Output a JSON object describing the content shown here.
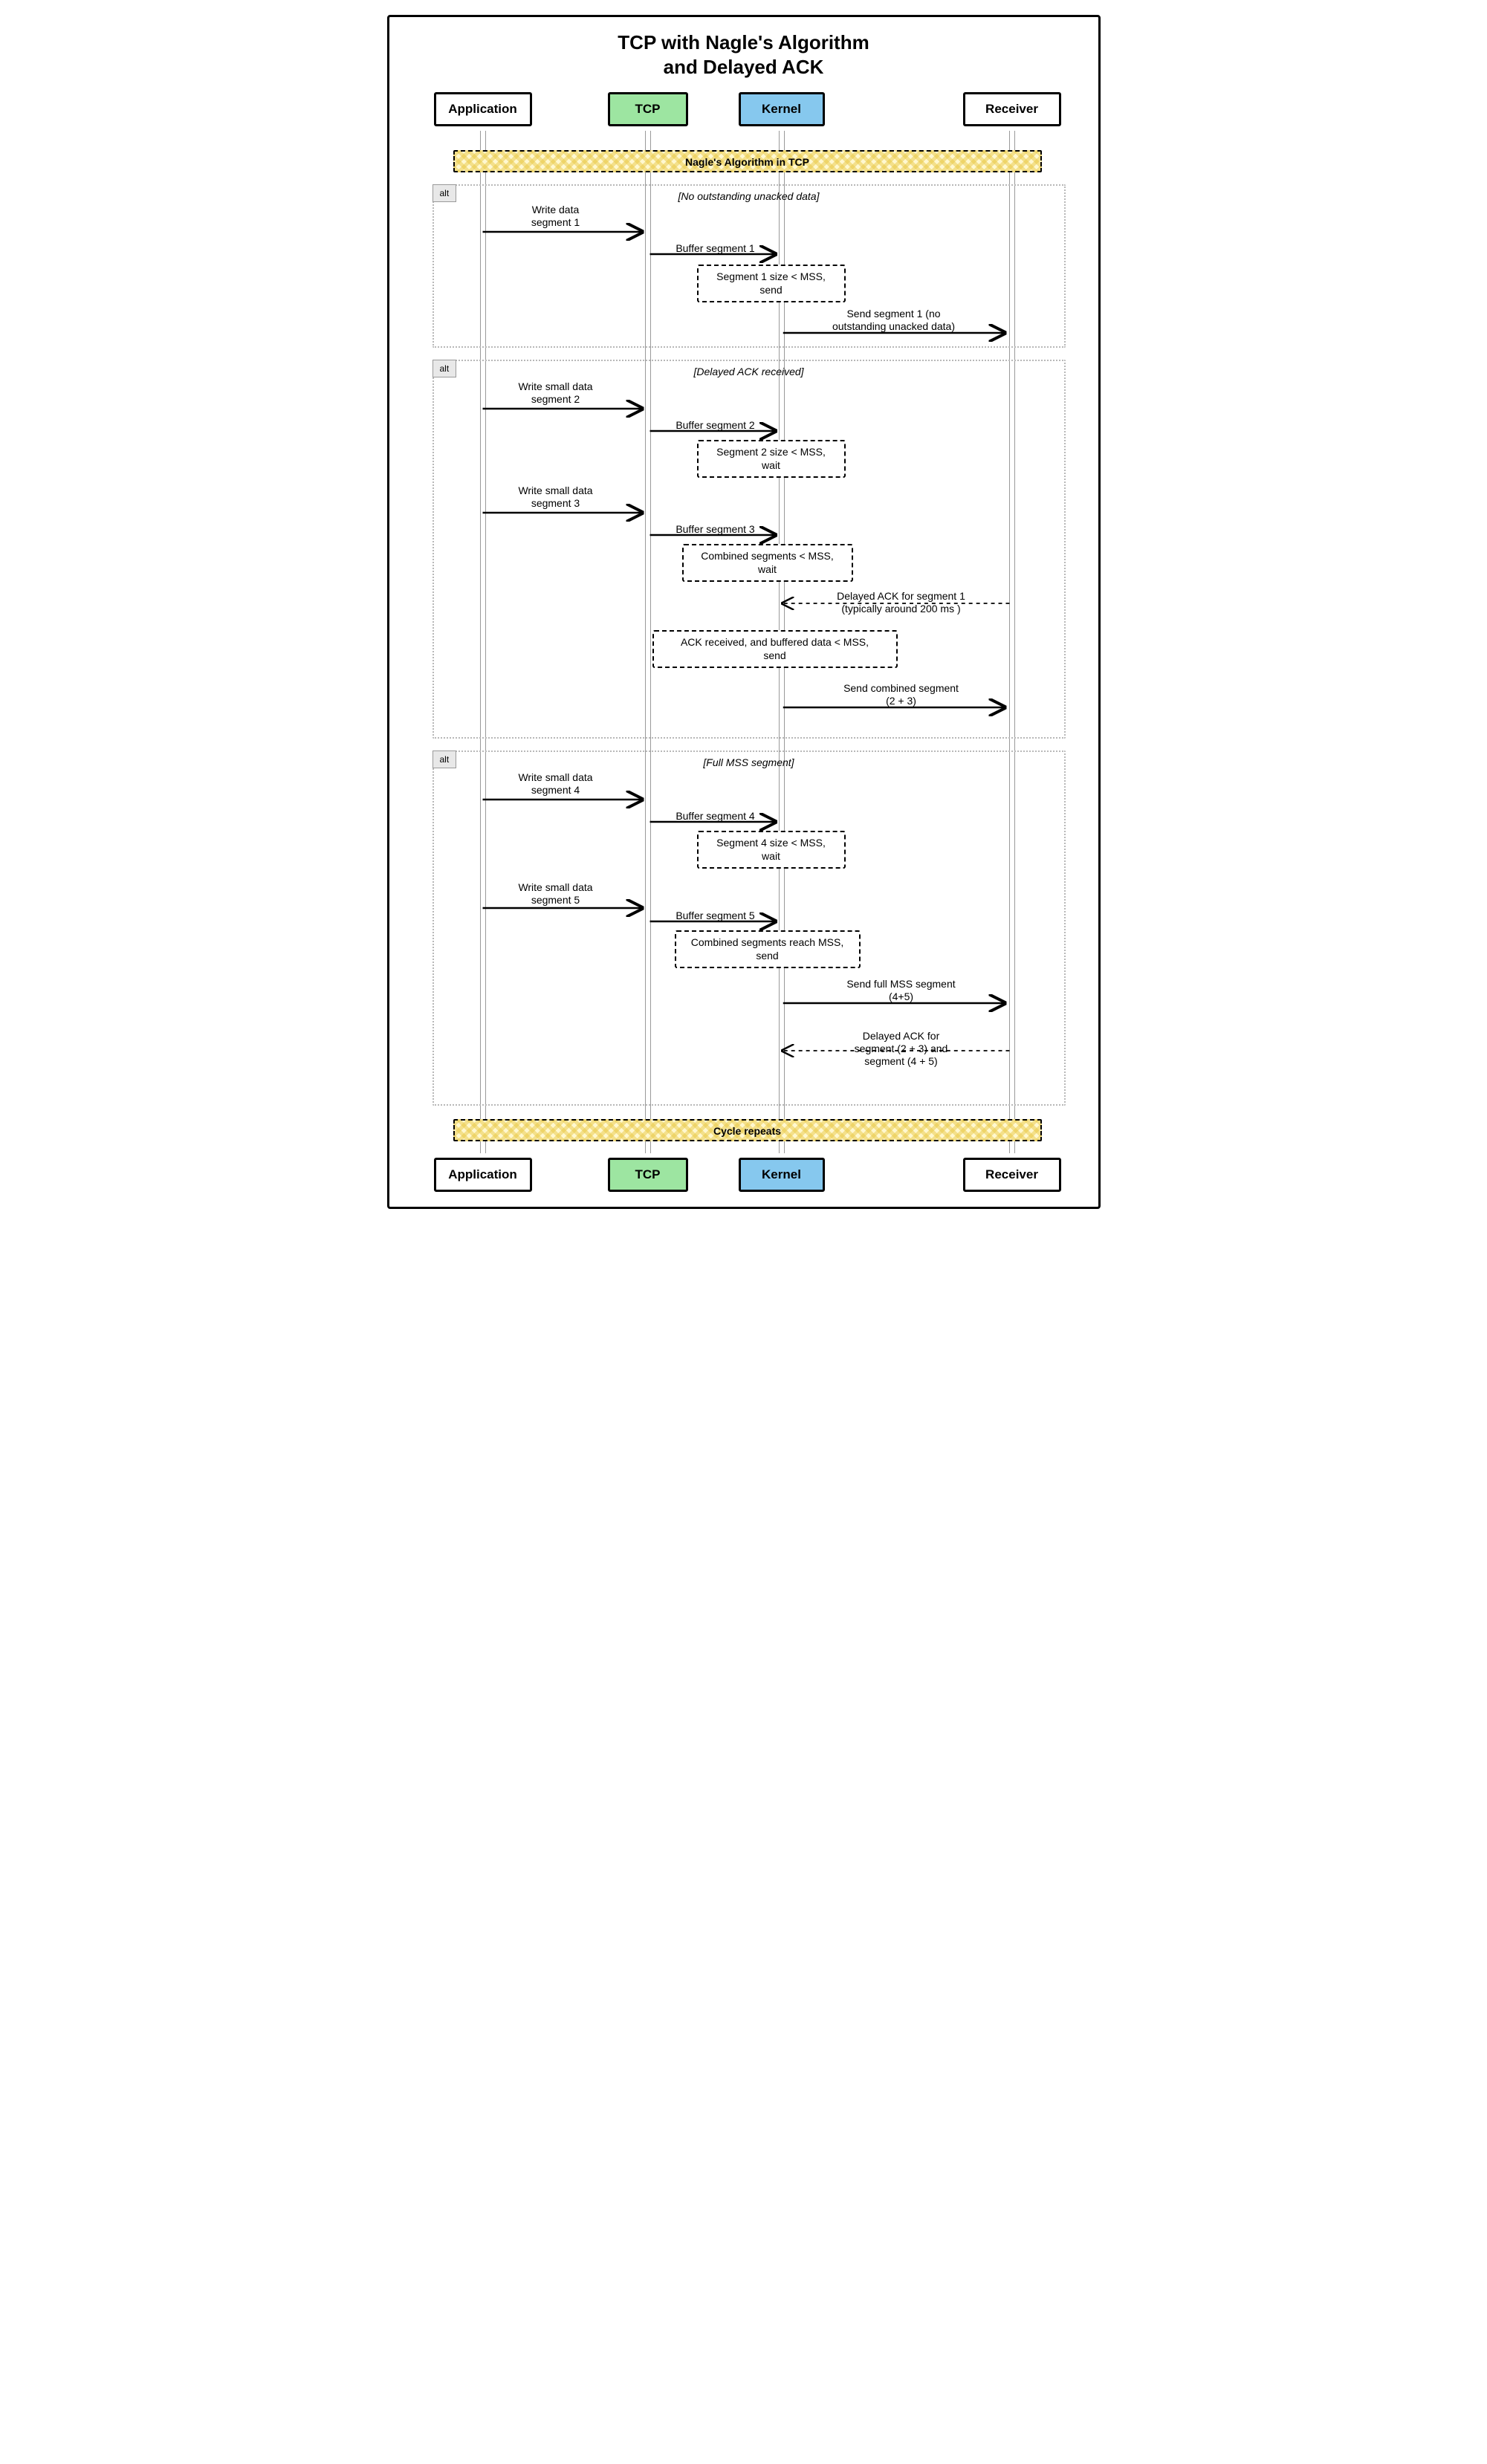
{
  "title_line1": "TCP with Nagle's Algorithm",
  "title_line2": "and Delayed ACK",
  "participants": {
    "app": "Application",
    "tcp": "TCP",
    "kernel": "Kernel",
    "receiver": "Receiver"
  },
  "banners": {
    "top": "Nagle's Algorithm in TCP",
    "bottom": "Cycle repeats"
  },
  "alt_label": "alt",
  "alt1": {
    "guard": "[No outstanding unacked data]",
    "m1": "Write data\nsegment 1",
    "m2": "Buffer segment 1",
    "note": "Segment 1 size < MSS,\nsend",
    "m3": "Send segment 1 (no\noutstanding unacked data)"
  },
  "alt2": {
    "guard": "[Delayed ACK received]",
    "m1": "Write small data\nsegment 2",
    "m2": "Buffer segment 2",
    "note1": "Segment 2 size < MSS,\nwait",
    "m3": "Write small data\nsegment 3",
    "m4": "Buffer segment 3",
    "note2": "Combined segments < MSS,\nwait",
    "m5": "Delayed ACK for segment 1\n(typically around 200 ms )",
    "note3": "ACK received, and buffered data < MSS,\nsend",
    "m6": "Send combined segment\n(2 + 3)"
  },
  "alt3": {
    "guard": "[Full MSS segment]",
    "m1": "Write small data\nsegment 4",
    "m2": "Buffer segment 4",
    "note1": "Segment 4 size < MSS,\nwait",
    "m3": "Write small data\nsegment 5",
    "m4": "Buffer segment 5",
    "note2": "Combined segments reach MSS,\nsend",
    "m5": "Send full MSS segment\n(4+5)",
    "m6": "Delayed ACK for\nsegment (2 + 3) and\nsegment (4 + 5)"
  }
}
